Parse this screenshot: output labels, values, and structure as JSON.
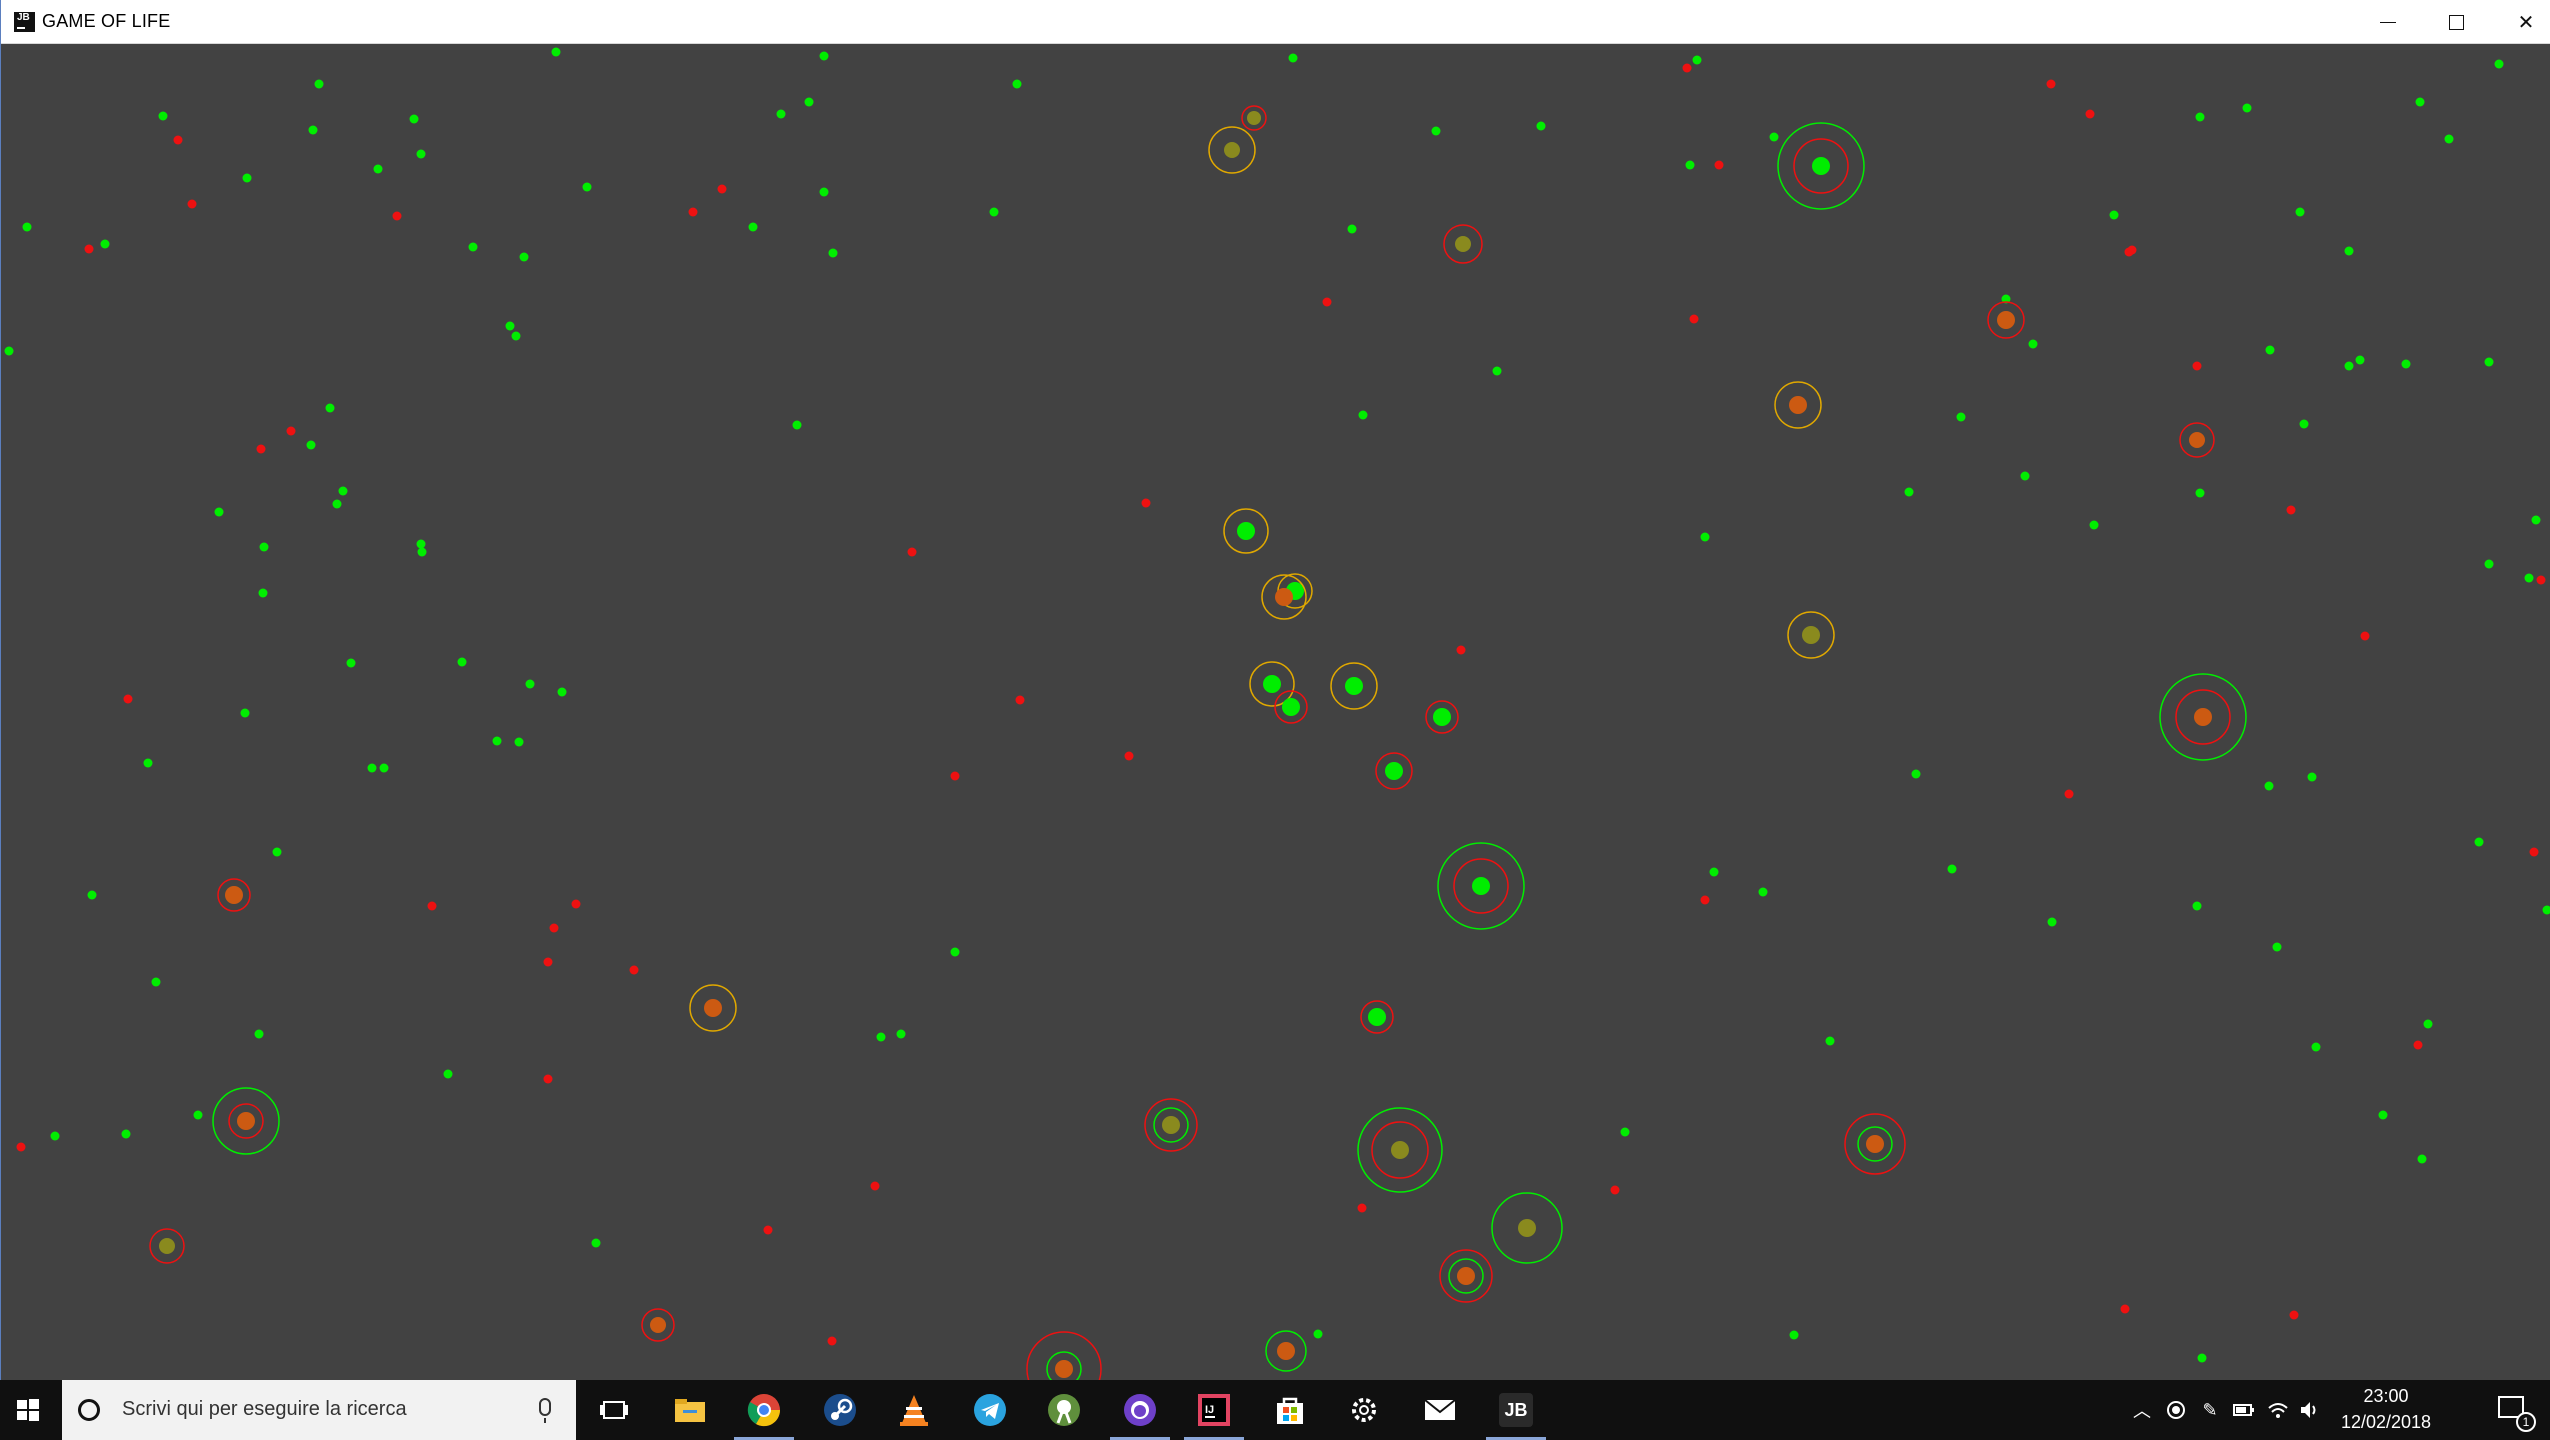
{
  "window": {
    "title": "GAME OF LIFE",
    "app_icon_text": "JB",
    "controls": [
      "minimize-icon",
      "maximize-icon",
      "close-icon"
    ]
  },
  "colors": {
    "background": "#424242",
    "green": "#00ee00",
    "red": "#ee1111",
    "olive": "#8a8a1e",
    "orange": "#cc5a12",
    "yellow_ring": "#e0a800",
    "taskbar": "#101010"
  },
  "taskbar": {
    "search_placeholder": "Scrivi qui per eseguire la ricerca",
    "apps": [
      {
        "name": "task-view-icon",
        "active": false
      },
      {
        "name": "file-explorer-icon",
        "active": false
      },
      {
        "name": "chrome-icon",
        "active": true
      },
      {
        "name": "steam-icon",
        "active": false
      },
      {
        "name": "vlc-icon",
        "active": false
      },
      {
        "name": "telegram-icon",
        "active": false
      },
      {
        "name": "android-studio-icon",
        "active": false
      },
      {
        "name": "github-desktop-icon",
        "active": true
      },
      {
        "name": "intellij-icon",
        "active": true
      },
      {
        "name": "store-icon",
        "active": false
      },
      {
        "name": "settings-icon",
        "active": false
      },
      {
        "name": "mail-icon",
        "active": false
      },
      {
        "name": "game-of-life-app-icon",
        "active": true
      }
    ],
    "active_app_label": "JB",
    "clock_time": "23:00",
    "clock_date": "12/02/2018",
    "notification_count": "1"
  }
}
